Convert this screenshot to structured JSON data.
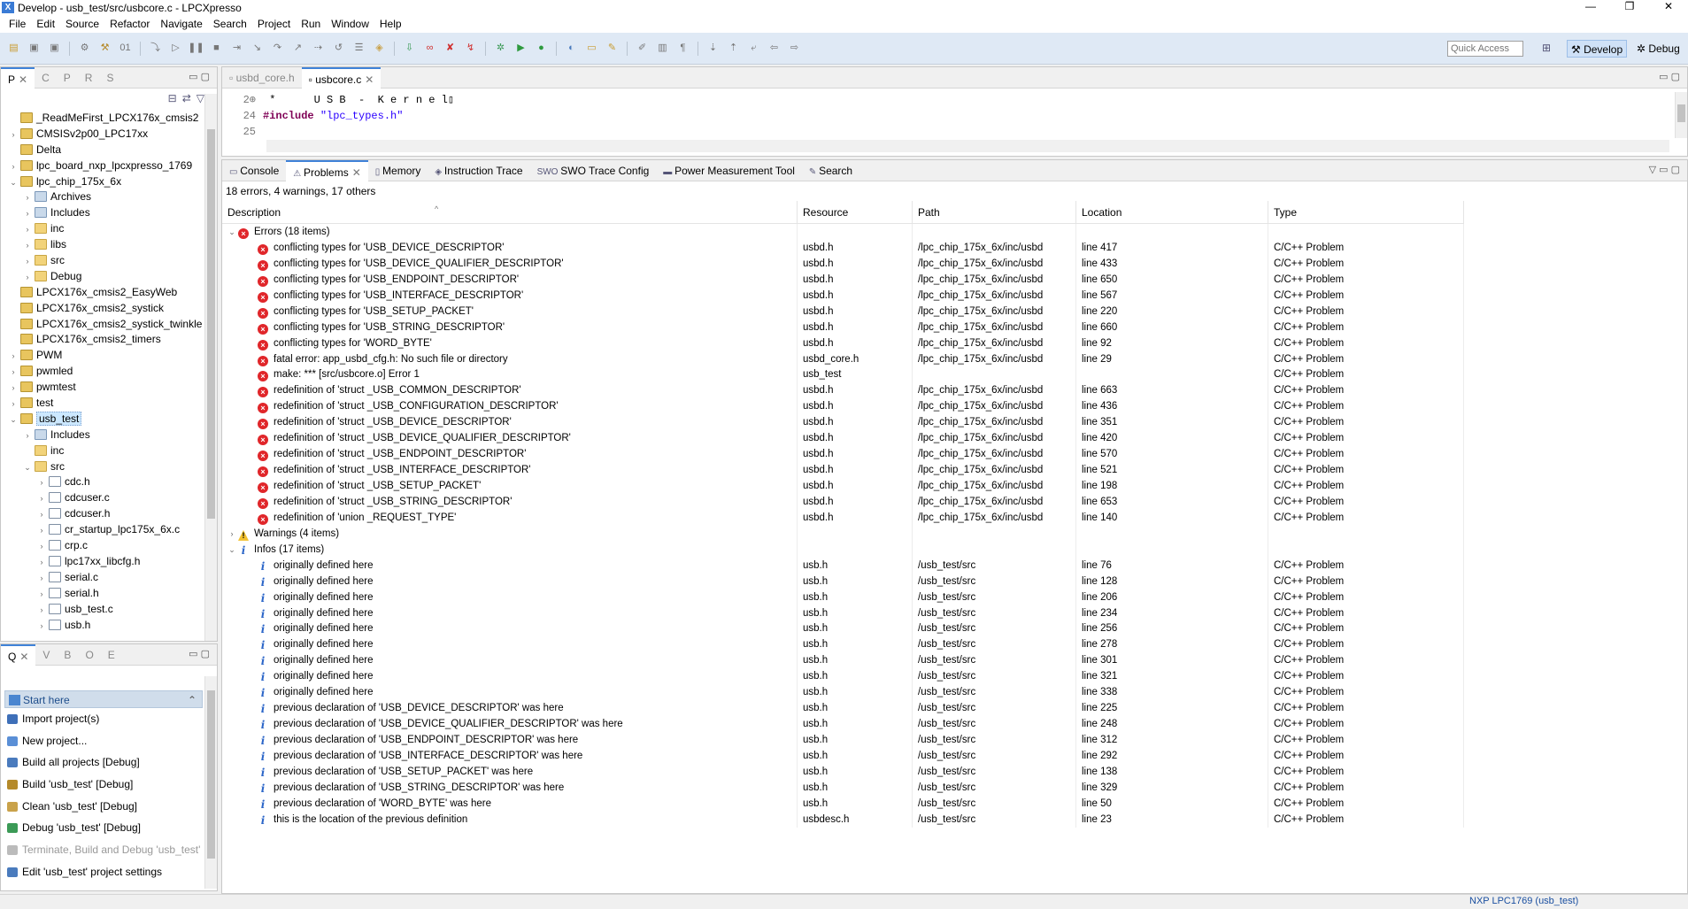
{
  "window": {
    "title": "Develop - usb_test/src/usbcore.c - LPCXpresso",
    "controls": [
      "—",
      "❐",
      "✕"
    ]
  },
  "menu": [
    "File",
    "Edit",
    "Source",
    "Refactor",
    "Navigate",
    "Search",
    "Project",
    "Run",
    "Window",
    "Help"
  ],
  "toolbar": {
    "quick_access_placeholder": "Quick Access",
    "perspective_develop": "Develop",
    "perspective_debug": "Debug"
  },
  "project_explorer": {
    "tabs": [
      "P",
      "C",
      "P",
      "R",
      "S"
    ],
    "items": [
      {
        "label": "_ReadMeFirst_LPCX176x_cmsis2",
        "level": 0,
        "icon": "proj",
        "expand": ""
      },
      {
        "label": "CMSISv2p00_LPC17xx",
        "level": 0,
        "icon": "proj",
        "expand": "›"
      },
      {
        "label": "Delta",
        "level": 0,
        "icon": "proj",
        "expand": ""
      },
      {
        "label": "lpc_board_nxp_lpcxpresso_1769",
        "level": 0,
        "icon": "proj",
        "expand": "›"
      },
      {
        "label": "lpc_chip_175x_6x",
        "level": 0,
        "icon": "proj",
        "expand": "⌄"
      },
      {
        "label": "Archives",
        "level": 1,
        "icon": "lib",
        "expand": "›"
      },
      {
        "label": "Includes",
        "level": 1,
        "icon": "lib",
        "expand": "›"
      },
      {
        "label": "inc",
        "level": 1,
        "icon": "folder",
        "expand": "›"
      },
      {
        "label": "libs",
        "level": 1,
        "icon": "folder",
        "expand": "›"
      },
      {
        "label": "src",
        "level": 1,
        "icon": "folder",
        "expand": "›"
      },
      {
        "label": "Debug",
        "level": 1,
        "icon": "folder",
        "expand": "›"
      },
      {
        "label": "LPCX176x_cmsis2_EasyWeb",
        "level": 0,
        "icon": "proj",
        "expand": ""
      },
      {
        "label": "LPCX176x_cmsis2_systick",
        "level": 0,
        "icon": "proj",
        "expand": ""
      },
      {
        "label": "LPCX176x_cmsis2_systick_twinkle",
        "level": 0,
        "icon": "proj",
        "expand": ""
      },
      {
        "label": "LPCX176x_cmsis2_timers",
        "level": 0,
        "icon": "proj",
        "expand": ""
      },
      {
        "label": "PWM",
        "level": 0,
        "icon": "proj",
        "expand": "›"
      },
      {
        "label": "pwmled",
        "level": 0,
        "icon": "proj",
        "expand": "›"
      },
      {
        "label": "pwmtest",
        "level": 0,
        "icon": "proj",
        "expand": "›"
      },
      {
        "label": "test",
        "level": 0,
        "icon": "proj",
        "expand": "›"
      },
      {
        "label": "usb_test",
        "level": 0,
        "icon": "proj",
        "expand": "⌄",
        "selected": true
      },
      {
        "label": "Includes",
        "level": 1,
        "icon": "lib",
        "expand": "›"
      },
      {
        "label": "inc",
        "level": 1,
        "icon": "folder",
        "expand": ""
      },
      {
        "label": "src",
        "level": 1,
        "icon": "folder",
        "expand": "⌄"
      },
      {
        "label": "cdc.h",
        "level": 2,
        "icon": "file",
        "expand": "›"
      },
      {
        "label": "cdcuser.c",
        "level": 2,
        "icon": "file",
        "expand": "›"
      },
      {
        "label": "cdcuser.h",
        "level": 2,
        "icon": "file",
        "expand": "›"
      },
      {
        "label": "cr_startup_lpc175x_6x.c",
        "level": 2,
        "icon": "file",
        "expand": "›"
      },
      {
        "label": "crp.c",
        "level": 2,
        "icon": "file",
        "expand": "›"
      },
      {
        "label": "lpc17xx_libcfg.h",
        "level": 2,
        "icon": "file",
        "expand": "›"
      },
      {
        "label": "serial.c",
        "level": 2,
        "icon": "file",
        "expand": "›"
      },
      {
        "label": "serial.h",
        "level": 2,
        "icon": "file",
        "expand": "›"
      },
      {
        "label": "usb_test.c",
        "level": 2,
        "icon": "file",
        "expand": "›"
      },
      {
        "label": "usb.h",
        "level": 2,
        "icon": "file",
        "expand": "›"
      }
    ]
  },
  "quickstart": {
    "tabs": [
      "Q",
      "V",
      "B",
      "O",
      "E"
    ],
    "header": "Start here",
    "items": [
      {
        "label": "Import project(s)",
        "color": "#3e6fb8",
        "disabled": false
      },
      {
        "label": "New project...",
        "color": "#5a8fd6",
        "disabled": false
      },
      {
        "label": "Build all projects [Debug]",
        "color": "#4a7bbd",
        "disabled": false
      },
      {
        "label": "Build 'usb_test' [Debug]",
        "color": "#b58a2a",
        "disabled": false
      },
      {
        "label": "Clean 'usb_test' [Debug]",
        "color": "#c9a24a",
        "disabled": false
      },
      {
        "label": "Debug 'usb_test' [Debug]",
        "color": "#3b9a56",
        "disabled": false
      },
      {
        "label": "Terminate, Build and Debug 'usb_test' [Debug]",
        "color": "#bbbbbb",
        "disabled": true
      },
      {
        "label": "Edit 'usb_test' project settings",
        "color": "#4a7bbd",
        "disabled": false
      }
    ]
  },
  "editor": {
    "tabs": [
      {
        "label": "usbd_core.h",
        "active": false
      },
      {
        "label": "usbcore.c",
        "active": true
      }
    ],
    "lines": [
      {
        "num": "2⊕",
        "text": " *      U S B  -  K e r n e l▯",
        "type": "comment"
      },
      {
        "num": "24",
        "kw": "#include",
        "str": "\"lpc_types.h\"",
        "type": "include"
      },
      {
        "num": "25",
        "text": "",
        "type": "blank"
      }
    ]
  },
  "problems": {
    "tabs": [
      {
        "label": "Console",
        "active": false
      },
      {
        "label": "Problems",
        "active": true
      },
      {
        "label": "Memory",
        "active": false
      },
      {
        "label": "Instruction Trace",
        "active": false
      },
      {
        "label": "SWO Trace Config",
        "active": false
      },
      {
        "label": "Power Measurement Tool",
        "active": false
      },
      {
        "label": "Search",
        "active": false
      }
    ],
    "summary": "18 errors, 4 warnings, 17 others",
    "columns": [
      "Description",
      "Resource",
      "Path",
      "Location",
      "Type"
    ],
    "rows": [
      {
        "kind": "group",
        "sev": "error",
        "expand": "⌄",
        "desc": "Errors (18 items)"
      },
      {
        "kind": "item",
        "sev": "error",
        "desc": "conflicting types for 'USB_DEVICE_DESCRIPTOR'",
        "res": "usbd.h",
        "path": "/lpc_chip_175x_6x/inc/usbd",
        "loc": "line 417",
        "type": "C/C++ Problem"
      },
      {
        "kind": "item",
        "sev": "error",
        "desc": "conflicting types for 'USB_DEVICE_QUALIFIER_DESCRIPTOR'",
        "res": "usbd.h",
        "path": "/lpc_chip_175x_6x/inc/usbd",
        "loc": "line 433",
        "type": "C/C++ Problem"
      },
      {
        "kind": "item",
        "sev": "error",
        "desc": "conflicting types for 'USB_ENDPOINT_DESCRIPTOR'",
        "res": "usbd.h",
        "path": "/lpc_chip_175x_6x/inc/usbd",
        "loc": "line 650",
        "type": "C/C++ Problem"
      },
      {
        "kind": "item",
        "sev": "error",
        "desc": "conflicting types for 'USB_INTERFACE_DESCRIPTOR'",
        "res": "usbd.h",
        "path": "/lpc_chip_175x_6x/inc/usbd",
        "loc": "line 567",
        "type": "C/C++ Problem"
      },
      {
        "kind": "item",
        "sev": "error",
        "desc": "conflicting types for 'USB_SETUP_PACKET'",
        "res": "usbd.h",
        "path": "/lpc_chip_175x_6x/inc/usbd",
        "loc": "line 220",
        "type": "C/C++ Problem"
      },
      {
        "kind": "item",
        "sev": "error",
        "desc": "conflicting types for 'USB_STRING_DESCRIPTOR'",
        "res": "usbd.h",
        "path": "/lpc_chip_175x_6x/inc/usbd",
        "loc": "line 660",
        "type": "C/C++ Problem"
      },
      {
        "kind": "item",
        "sev": "error",
        "desc": "conflicting types for 'WORD_BYTE'",
        "res": "usbd.h",
        "path": "/lpc_chip_175x_6x/inc/usbd",
        "loc": "line 92",
        "type": "C/C++ Problem"
      },
      {
        "kind": "item",
        "sev": "error",
        "desc": "fatal error: app_usbd_cfg.h: No such file or directory",
        "res": "usbd_core.h",
        "path": "/lpc_chip_175x_6x/inc/usbd",
        "loc": "line 29",
        "type": "C/C++ Problem"
      },
      {
        "kind": "item",
        "sev": "error",
        "desc": "make: *** [src/usbcore.o] Error 1",
        "res": "usb_test",
        "path": "",
        "loc": "",
        "type": "C/C++ Problem"
      },
      {
        "kind": "item",
        "sev": "error",
        "desc": "redefinition of 'struct _USB_COMMON_DESCRIPTOR'",
        "res": "usbd.h",
        "path": "/lpc_chip_175x_6x/inc/usbd",
        "loc": "line 663",
        "type": "C/C++ Problem"
      },
      {
        "kind": "item",
        "sev": "error",
        "desc": "redefinition of 'struct _USB_CONFIGURATION_DESCRIPTOR'",
        "res": "usbd.h",
        "path": "/lpc_chip_175x_6x/inc/usbd",
        "loc": "line 436",
        "type": "C/C++ Problem"
      },
      {
        "kind": "item",
        "sev": "error",
        "desc": "redefinition of 'struct _USB_DEVICE_DESCRIPTOR'",
        "res": "usbd.h",
        "path": "/lpc_chip_175x_6x/inc/usbd",
        "loc": "line 351",
        "type": "C/C++ Problem"
      },
      {
        "kind": "item",
        "sev": "error",
        "desc": "redefinition of 'struct _USB_DEVICE_QUALIFIER_DESCRIPTOR'",
        "res": "usbd.h",
        "path": "/lpc_chip_175x_6x/inc/usbd",
        "loc": "line 420",
        "type": "C/C++ Problem"
      },
      {
        "kind": "item",
        "sev": "error",
        "desc": "redefinition of 'struct _USB_ENDPOINT_DESCRIPTOR'",
        "res": "usbd.h",
        "path": "/lpc_chip_175x_6x/inc/usbd",
        "loc": "line 570",
        "type": "C/C++ Problem"
      },
      {
        "kind": "item",
        "sev": "error",
        "desc": "redefinition of 'struct _USB_INTERFACE_DESCRIPTOR'",
        "res": "usbd.h",
        "path": "/lpc_chip_175x_6x/inc/usbd",
        "loc": "line 521",
        "type": "C/C++ Problem"
      },
      {
        "kind": "item",
        "sev": "error",
        "desc": "redefinition of 'struct _USB_SETUP_PACKET'",
        "res": "usbd.h",
        "path": "/lpc_chip_175x_6x/inc/usbd",
        "loc": "line 198",
        "type": "C/C++ Problem"
      },
      {
        "kind": "item",
        "sev": "error",
        "desc": "redefinition of 'struct _USB_STRING_DESCRIPTOR'",
        "res": "usbd.h",
        "path": "/lpc_chip_175x_6x/inc/usbd",
        "loc": "line 653",
        "type": "C/C++ Problem"
      },
      {
        "kind": "item",
        "sev": "error",
        "desc": "redefinition of 'union _REQUEST_TYPE'",
        "res": "usbd.h",
        "path": "/lpc_chip_175x_6x/inc/usbd",
        "loc": "line 140",
        "type": "C/C++ Problem"
      },
      {
        "kind": "group",
        "sev": "warning",
        "expand": "›",
        "desc": "Warnings (4 items)"
      },
      {
        "kind": "group",
        "sev": "info",
        "expand": "⌄",
        "desc": "Infos (17 items)"
      },
      {
        "kind": "item",
        "sev": "info",
        "desc": "originally defined here",
        "res": "usb.h",
        "path": "/usb_test/src",
        "loc": "line 76",
        "type": "C/C++ Problem"
      },
      {
        "kind": "item",
        "sev": "info",
        "desc": "originally defined here",
        "res": "usb.h",
        "path": "/usb_test/src",
        "loc": "line 128",
        "type": "C/C++ Problem"
      },
      {
        "kind": "item",
        "sev": "info",
        "desc": "originally defined here",
        "res": "usb.h",
        "path": "/usb_test/src",
        "loc": "line 206",
        "type": "C/C++ Problem"
      },
      {
        "kind": "item",
        "sev": "info",
        "desc": "originally defined here",
        "res": "usb.h",
        "path": "/usb_test/src",
        "loc": "line 234",
        "type": "C/C++ Problem"
      },
      {
        "kind": "item",
        "sev": "info",
        "desc": "originally defined here",
        "res": "usb.h",
        "path": "/usb_test/src",
        "loc": "line 256",
        "type": "C/C++ Problem"
      },
      {
        "kind": "item",
        "sev": "info",
        "desc": "originally defined here",
        "res": "usb.h",
        "path": "/usb_test/src",
        "loc": "line 278",
        "type": "C/C++ Problem"
      },
      {
        "kind": "item",
        "sev": "info",
        "desc": "originally defined here",
        "res": "usb.h",
        "path": "/usb_test/src",
        "loc": "line 301",
        "type": "C/C++ Problem"
      },
      {
        "kind": "item",
        "sev": "info",
        "desc": "originally defined here",
        "res": "usb.h",
        "path": "/usb_test/src",
        "loc": "line 321",
        "type": "C/C++ Problem"
      },
      {
        "kind": "item",
        "sev": "info",
        "desc": "originally defined here",
        "res": "usb.h",
        "path": "/usb_test/src",
        "loc": "line 338",
        "type": "C/C++ Problem"
      },
      {
        "kind": "item",
        "sev": "info",
        "desc": "previous declaration of 'USB_DEVICE_DESCRIPTOR' was here",
        "res": "usb.h",
        "path": "/usb_test/src",
        "loc": "line 225",
        "type": "C/C++ Problem"
      },
      {
        "kind": "item",
        "sev": "info",
        "desc": "previous declaration of 'USB_DEVICE_QUALIFIER_DESCRIPTOR' was here",
        "res": "usb.h",
        "path": "/usb_test/src",
        "loc": "line 248",
        "type": "C/C++ Problem"
      },
      {
        "kind": "item",
        "sev": "info",
        "desc": "previous declaration of 'USB_ENDPOINT_DESCRIPTOR' was here",
        "res": "usb.h",
        "path": "/usb_test/src",
        "loc": "line 312",
        "type": "C/C++ Problem"
      },
      {
        "kind": "item",
        "sev": "info",
        "desc": "previous declaration of 'USB_INTERFACE_DESCRIPTOR' was here",
        "res": "usb.h",
        "path": "/usb_test/src",
        "loc": "line 292",
        "type": "C/C++ Problem"
      },
      {
        "kind": "item",
        "sev": "info",
        "desc": "previous declaration of 'USB_SETUP_PACKET' was here",
        "res": "usb.h",
        "path": "/usb_test/src",
        "loc": "line 138",
        "type": "C/C++ Problem"
      },
      {
        "kind": "item",
        "sev": "info",
        "desc": "previous declaration of 'USB_STRING_DESCRIPTOR' was here",
        "res": "usb.h",
        "path": "/usb_test/src",
        "loc": "line 329",
        "type": "C/C++ Problem"
      },
      {
        "kind": "item",
        "sev": "info",
        "desc": "previous declaration of 'WORD_BYTE' was here",
        "res": "usb.h",
        "path": "/usb_test/src",
        "loc": "line 50",
        "type": "C/C++ Problem"
      },
      {
        "kind": "item",
        "sev": "info",
        "desc": "this is the location of the previous definition",
        "res": "usbdesc.h",
        "path": "/usb_test/src",
        "loc": "line 23",
        "type": "C/C++ Problem"
      }
    ]
  },
  "status": {
    "target": "NXP LPC1769 (usb_test)"
  },
  "colors": {
    "accent": "#3f82d8",
    "error": "#e0262a",
    "warning": "#f2c12e",
    "info": "#2c66c8"
  }
}
